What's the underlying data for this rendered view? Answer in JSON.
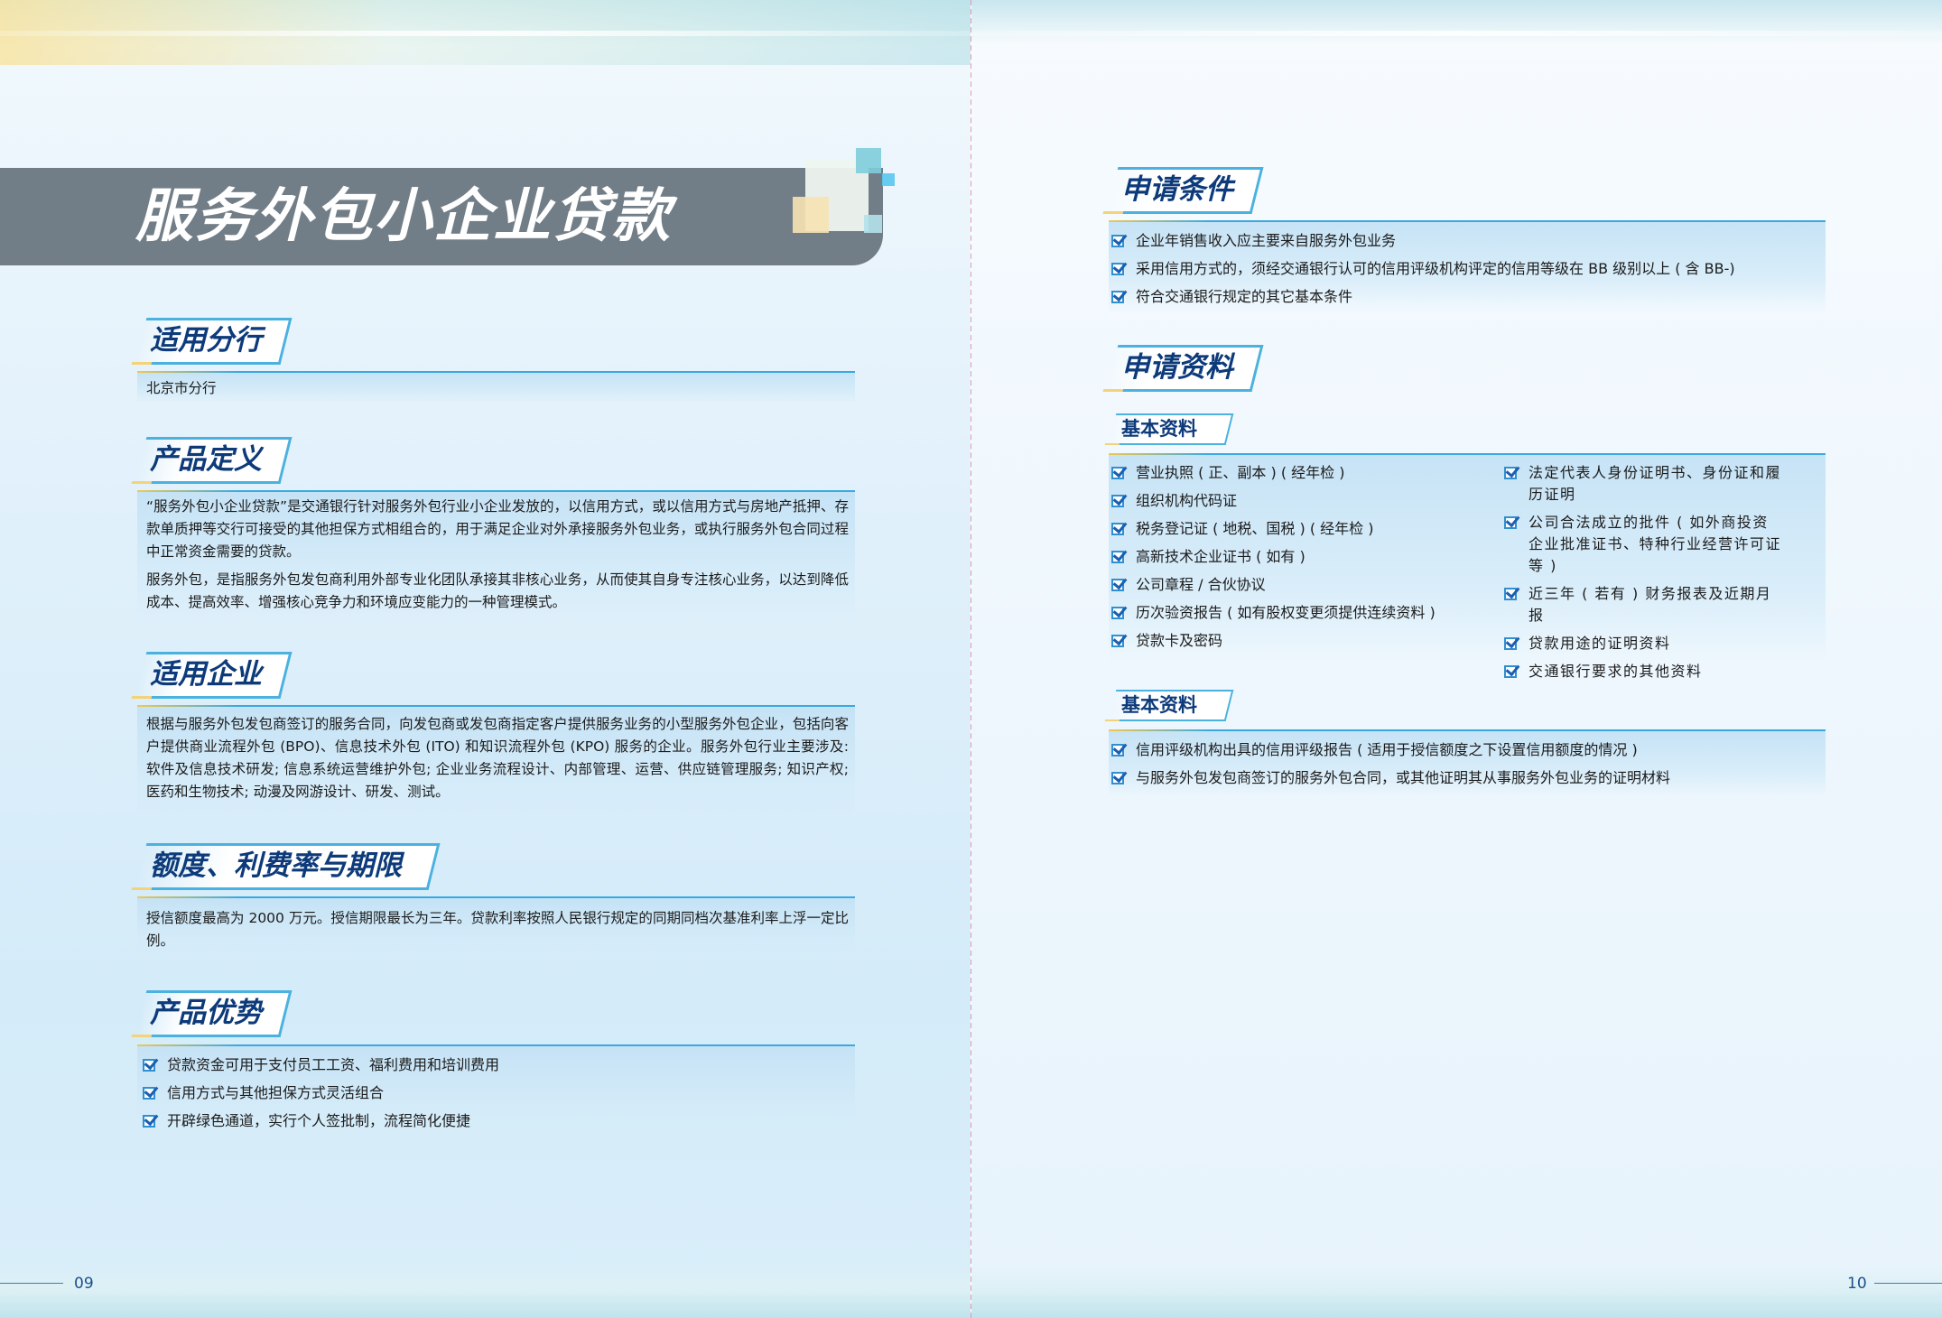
{
  "left": {
    "title": "服务外包小企业贷款",
    "sections": {
      "branch": {
        "heading": "适用分行",
        "text": "北京市分行"
      },
      "definition": {
        "heading": "产品定义",
        "p1": "“服务外包小企业贷款”是交通银行针对服务外包行业小企业发放的，以信用方式，或以信用方式与房地产抵押、存款单质押等交行可接受的其他担保方式相组合的，用于满足企业对外承接服务外包业务，或执行服务外包合同过程中正常资金需要的贷款。",
        "p2": "服务外包，是指服务外包发包商利用外部专业化团队承接其非核心业务，从而使其自身专注核心业务，以达到降低成本、提高效率、增强核心竞争力和环境应变能力的一种管理模式。"
      },
      "enterprise": {
        "heading": "适用企业",
        "text": "根据与服务外包发包商签订的服务合同，向发包商或发包商指定客户提供服务业务的小型服务外包企业，包括向客户提供商业流程外包 (BPO)、信息技术外包 (ITO) 和知识流程外包 (KPO) 服务的企业。服务外包行业主要涉及: 软件及信息技术研发; 信息系统运营维护外包; 企业业务流程设计、内部管理、运营、供应链管理服务; 知识产权; 医药和生物技术; 动漫及网游设计、研发、测试。"
      },
      "limit": {
        "heading": "额度、利费率与期限",
        "text": "授信额度最高为 2000 万元。授信期限最长为三年。贷款利率按照人民银行规定的同期同档次基准利率上浮一定比例。"
      },
      "advantages": {
        "heading": "产品优势",
        "items": [
          "贷款资金可用于支付员工工资、福利费用和培训费用",
          "信用方式与其他担保方式灵活组合",
          "开辟绿色通道，实行个人签批制，流程简化便捷"
        ]
      }
    },
    "page_number": "09"
  },
  "right": {
    "conditions": {
      "heading": "申请条件",
      "items": [
        "企业年销售收入应主要来自服务外包业务",
        "采用信用方式的，须经交通银行认可的信用评级机构评定的信用等级在 BB 级别以上 ( 含 BB-)",
        "符合交通银行规定的其它基本条件"
      ]
    },
    "materials": {
      "heading": "申请资料",
      "basic1": {
        "label": "基本资料",
        "col1": [
          "营业执照 ( 正、副本 ) ( 经年检 )",
          "组织机构代码证",
          "税务登记证 ( 地税、国税 ) ( 经年检 )",
          "高新技术企业证书 ( 如有 )",
          "公司章程 / 合伙协议",
          "历次验资报告 ( 如有股权变更须提供连续资料 )",
          "贷款卡及密码"
        ],
        "col2": [
          "法定代表人身份证明书、身份证和履历证明",
          "公司合法成立的批件 ( 如外商投资企业批准证书、特种行业经营许可证等 )",
          "近三年 ( 若有 ) 财务报表及近期月报",
          "贷款用途的证明资料",
          "交通银行要求的其他资料"
        ]
      },
      "basic2": {
        "label": "基本资料",
        "items": [
          "信用评级机构出具的信用评级报告 ( 适用于授信额度之下设置信用额度的情况 )",
          "与服务外包发包商签订的服务外包合同，或其他证明其从事服务外包业务的证明材料"
        ]
      }
    },
    "page_number": "10"
  }
}
